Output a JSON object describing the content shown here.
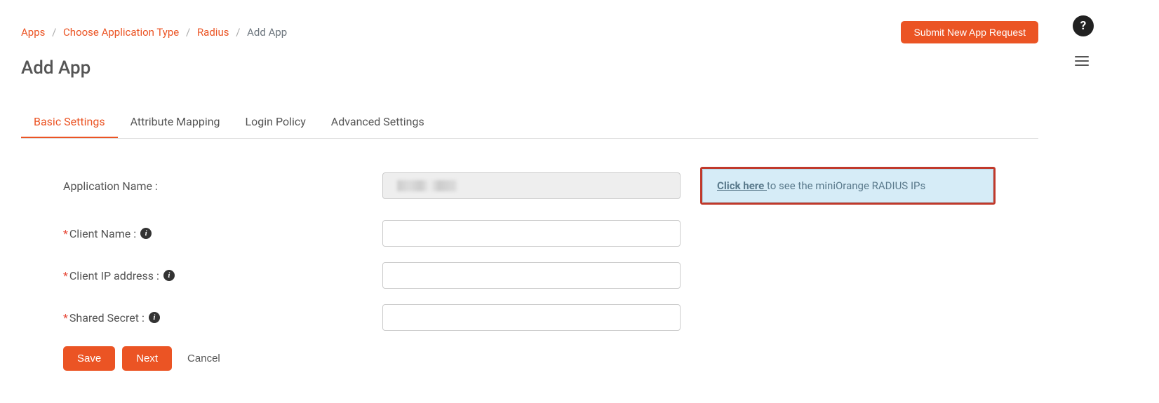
{
  "breadcrumb": {
    "items": [
      {
        "label": "Apps"
      },
      {
        "label": "Choose Application Type"
      },
      {
        "label": "Radius"
      }
    ],
    "current": "Add App"
  },
  "header": {
    "submit_label": "Submit New App Request",
    "help_label": "?"
  },
  "page": {
    "title": "Add App"
  },
  "tabs": [
    {
      "label": "Basic Settings",
      "active": true
    },
    {
      "label": "Attribute Mapping",
      "active": false
    },
    {
      "label": "Login Policy",
      "active": false
    },
    {
      "label": "Advanced Settings",
      "active": false
    }
  ],
  "form": {
    "app_name_label": "Application Name :",
    "client_name_label": "Client Name :",
    "client_ip_label": "Client IP address :",
    "shared_secret_label": "Shared Secret :",
    "app_name_value": "",
    "client_name_value": "",
    "client_ip_value": "",
    "shared_secret_value": ""
  },
  "info_box": {
    "link_text": "Click here ",
    "rest_text": "to see the miniOrange RADIUS IPs"
  },
  "buttons": {
    "save": "Save",
    "next": "Next",
    "cancel": "Cancel"
  }
}
